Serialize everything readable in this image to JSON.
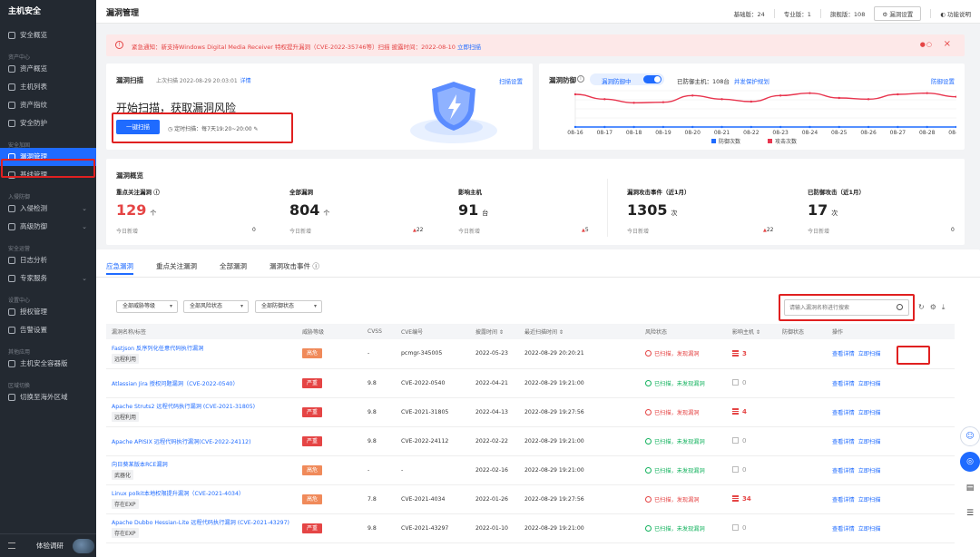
{
  "sidebar": {
    "brand": "主机安全",
    "sec0": {
      "item": "安全概览"
    },
    "sec1": {
      "title": "资产中心",
      "items": [
        "资产概览",
        "主机列表",
        "资产指纹",
        "安全防护"
      ]
    },
    "sec2": {
      "title": "安全加固",
      "items": [
        "漏洞管理",
        "基线管理"
      ]
    },
    "sec3": {
      "title": "入侵防御",
      "items": [
        "入侵检测",
        "高级防御"
      ]
    },
    "sec4": {
      "title": "安全运营",
      "items": [
        "日志分析",
        "专家服务"
      ]
    },
    "sec5": {
      "title": "设置中心",
      "items": [
        "授权管理",
        "告警设置"
      ]
    },
    "sec6": {
      "title": "其他应用",
      "items": [
        "主机安全容器版"
      ]
    },
    "sec7": {
      "title": "区域切换",
      "items": [
        "切换至海外区域"
      ]
    },
    "user": "体验调研"
  },
  "header": {
    "title": "漏洞管理",
    "edition_basic": "基础版：24",
    "edition_pro": "专业版：1",
    "edition_flagship": "旗舰版：108",
    "settings_button": "漏洞设置",
    "help": "功能说明"
  },
  "notice": {
    "text": "紧急通知：新支持Windows Digital Media Receiver 特权提升漏洞（CVE-2022-35746等）扫描 披露时间：2022-08-10",
    "link": "立即扫描",
    "close": "×"
  },
  "scan": {
    "title": "漏洞扫描",
    "last_scan": "上次扫描 2022-08-29 20:03:01",
    "detail": "详情",
    "settings": "扫描设置",
    "headline": "开始扫描，获取漏洞风险",
    "button": "一键扫描",
    "schedule": "定时扫描：每7天19:20~20:00"
  },
  "protect": {
    "title": "漏洞防御",
    "toggle_label": "漏洞防御中",
    "protected_hosts": "已防御主机：108台",
    "scope_link": "并发保护规划",
    "settings": "防御设置",
    "legend_defend": "防御次数",
    "legend_attack": "攻击次数",
    "colors": {
      "defend": "#1f6bff",
      "attack": "#e8364f"
    }
  },
  "chart_data": {
    "type": "line",
    "categories": [
      "08-16",
      "08-17",
      "08-18",
      "08-19",
      "08-20",
      "08-21",
      "08-22",
      "08-23",
      "08-24",
      "08-25",
      "08-26",
      "08-27",
      "08-28",
      "08-29"
    ],
    "series": [
      {
        "name": "防御次数",
        "values": [
          0,
          0,
          0,
          0,
          0,
          0,
          0,
          0,
          0,
          0,
          0,
          0,
          0,
          0
        ]
      },
      {
        "name": "攻击次数",
        "values": [
          270,
          230,
          200,
          205,
          260,
          230,
          210,
          260,
          280,
          240,
          230,
          270,
          280,
          250
        ]
      }
    ],
    "ylim": [
      0,
      300
    ],
    "grid": true,
    "legend": "bottom"
  },
  "overview": {
    "title": "漏洞概览",
    "foot": "今日新增",
    "cols": [
      {
        "label": "重点关注漏洞",
        "value": "129",
        "unit": "个",
        "inc": "0"
      },
      {
        "label": "全部漏洞",
        "value": "804",
        "unit": "个",
        "inc": "22"
      },
      {
        "label": "影响主机",
        "value": "91",
        "unit": "台",
        "inc": "5"
      },
      {
        "label": "漏洞攻击事件（近1月）",
        "value": "1305",
        "unit": "次",
        "inc": "22"
      },
      {
        "label": "已防御攻击（近1月）",
        "value": "17",
        "unit": "次",
        "inc": "0"
      }
    ]
  },
  "tabs": [
    "应急漏洞",
    "重点关注漏洞",
    "全部漏洞",
    "漏洞攻击事件"
  ],
  "filters": [
    "全部威胁等级",
    "全部风险状态",
    "全部防御状态"
  ],
  "search": {
    "placeholder": "请输入漏洞名称进行搜索"
  },
  "table": {
    "headers": [
      "漏洞名称/标签",
      "威胁等级",
      "CVSS",
      "CVE编号",
      "披露时间 ⇕",
      "最近扫描时间 ⇕",
      "风险状态",
      "影响主机 ⇕",
      "防御状态",
      "操作"
    ],
    "op_view": "查看详情",
    "op_scan": "立即扫描",
    "rows": [
      {
        "name": "Fastjson 反序列化任意代码执行漏洞",
        "tag": "远程利用",
        "level": "高危",
        "cvss": "-",
        "cve": "pcmgr-345005",
        "disclosed": "2022-05-23",
        "scanned": "2022-08-29 20:20:21",
        "status": "已扫描，发现漏洞",
        "status_bad": true,
        "hosts": "3"
      },
      {
        "name": "Atlassian Jira 授权问题漏洞（CVE-2022-0540）",
        "tag": "",
        "level": "严重",
        "cvss": "9.8",
        "cve": "CVE-2022-0540",
        "disclosed": "2022-04-21",
        "scanned": "2022-08-29 19:21:00",
        "status": "已扫描，未发现漏洞",
        "status_bad": false,
        "hosts": "0"
      },
      {
        "name": "Apache Struts2 远程代码执行漏洞 (CVE-2021-31805)",
        "tag": "远程利用",
        "level": "严重",
        "cvss": "9.8",
        "cve": "CVE-2021-31805",
        "disclosed": "2022-04-13",
        "scanned": "2022-08-29 19:27:56",
        "status": "已扫描，发现漏洞",
        "status_bad": true,
        "hosts": "4"
      },
      {
        "name": "Apache APISIX 远程代码执行漏洞(CVE-2022-24112)",
        "tag": "",
        "level": "严重",
        "cvss": "9.8",
        "cve": "CVE-2022-24112",
        "disclosed": "2022-02-22",
        "scanned": "2022-08-29 19:21:00",
        "status": "已扫描，未发现漏洞",
        "status_bad": false,
        "hosts": "0"
      },
      {
        "name": "向日葵某版本RCE漏洞",
        "tag": "武器化",
        "level": "高危",
        "cvss": "-",
        "cve": "-",
        "disclosed": "2022-02-16",
        "scanned": "2022-08-29 19:21:00",
        "status": "已扫描，未发现漏洞",
        "status_bad": false,
        "hosts": "0"
      },
      {
        "name": "Linux polkit本地权限提升漏洞（CVE-2021-4034）",
        "tag": "存在EXP",
        "level": "高危",
        "cvss": "7.8",
        "cve": "CVE-2021-4034",
        "disclosed": "2022-01-26",
        "scanned": "2022-08-29 19:27:56",
        "status": "已扫描，发现漏洞",
        "status_bad": true,
        "hosts": "34"
      },
      {
        "name": "Apache Dubbo Hessian-Lite 远程代码执行漏洞 (CVE-2021-43297)",
        "tag": "存在EXP",
        "level": "严重",
        "cvss": "9.8",
        "cve": "CVE-2021-43297",
        "disclosed": "2022-01-10",
        "scanned": "2022-08-29 19:21:00",
        "status": "已扫描，未发现漏洞",
        "status_bad": false,
        "hosts": "0"
      }
    ]
  }
}
